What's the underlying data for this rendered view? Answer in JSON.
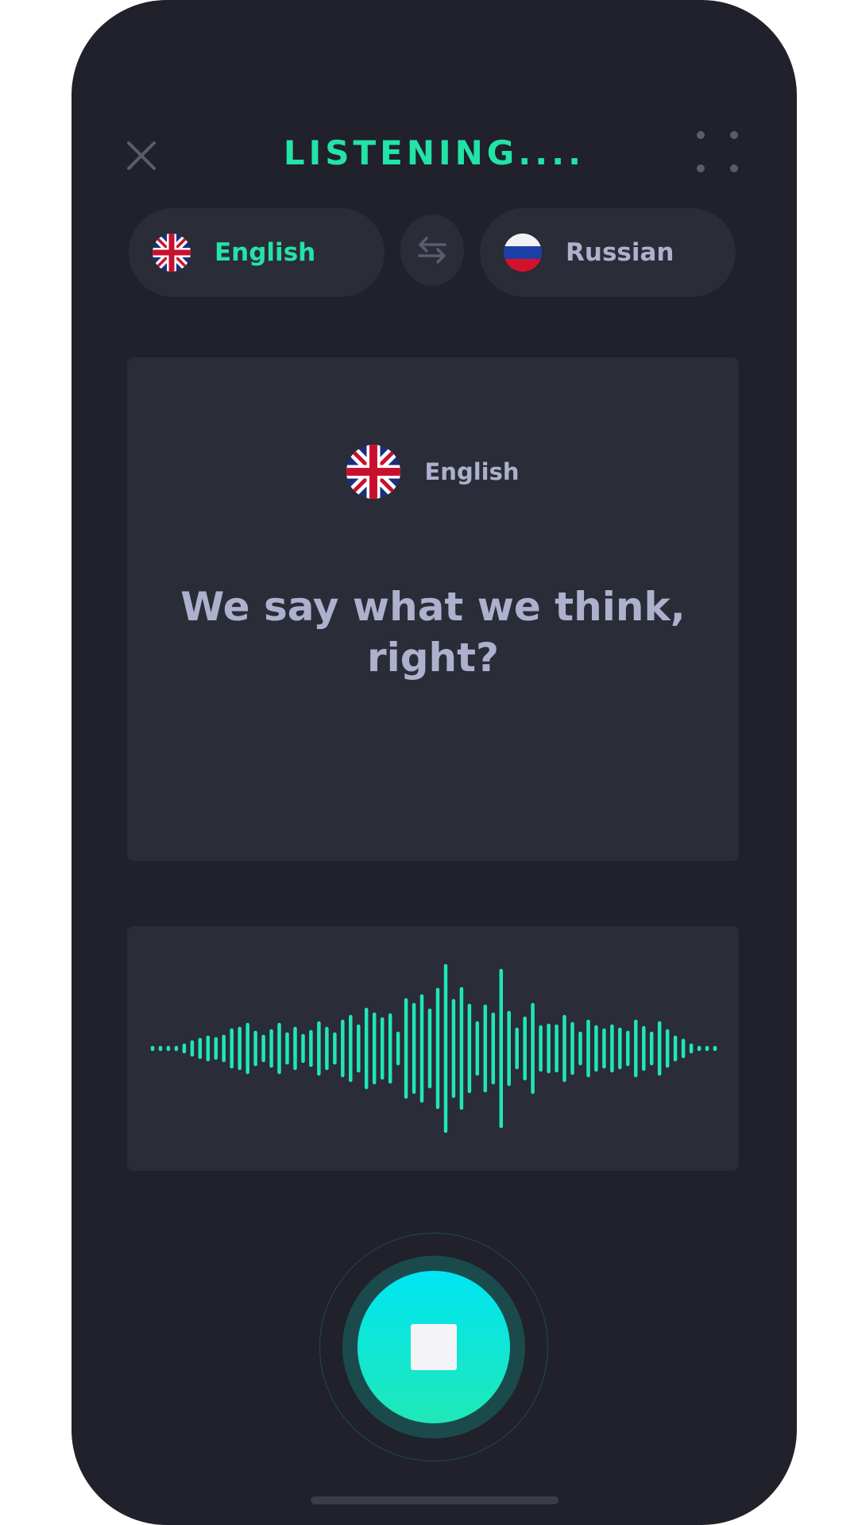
{
  "header": {
    "title": "LISTENING....",
    "close_icon": "close-icon",
    "menu_icon": "grid-dots-icon"
  },
  "language_selector": {
    "source": {
      "label": "English",
      "flag": "uk-flag-icon"
    },
    "swap_icon": "swap-arrows-icon",
    "target": {
      "label": "Russian",
      "flag": "russia-flag-icon"
    }
  },
  "transcript": {
    "language": "English",
    "flag": "uk-flag-icon",
    "text": "We say what we think, right?"
  },
  "waveform": {
    "icon": "audio-waveform",
    "color": "#1fe6b8"
  },
  "record": {
    "icon": "stop-icon",
    "state": "recording"
  },
  "colors": {
    "accent": "#23e3a7",
    "background": "#20212b",
    "card": "#2a2c37",
    "muted_text": "#aeb1cd"
  }
}
